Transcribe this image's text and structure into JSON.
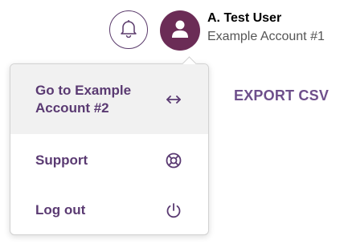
{
  "header": {
    "notifications_icon": "bell-icon",
    "avatar_icon": "user-icon",
    "user_name": "A. Test User",
    "account_name": "Example Account #1"
  },
  "page": {
    "export_label": "EXPORT CSV"
  },
  "menu": {
    "items": [
      {
        "label": "Go to Example Account #2",
        "icon": "swap-arrows-icon"
      },
      {
        "label": "Support",
        "icon": "lifebuoy-icon"
      },
      {
        "label": "Log out",
        "icon": "power-icon"
      }
    ]
  },
  "colors": {
    "accent": "#5a3a72",
    "avatar_bg": "#6b2c56",
    "export_text": "#6e4f8b",
    "highlight_bg": "#f1f1f1"
  }
}
